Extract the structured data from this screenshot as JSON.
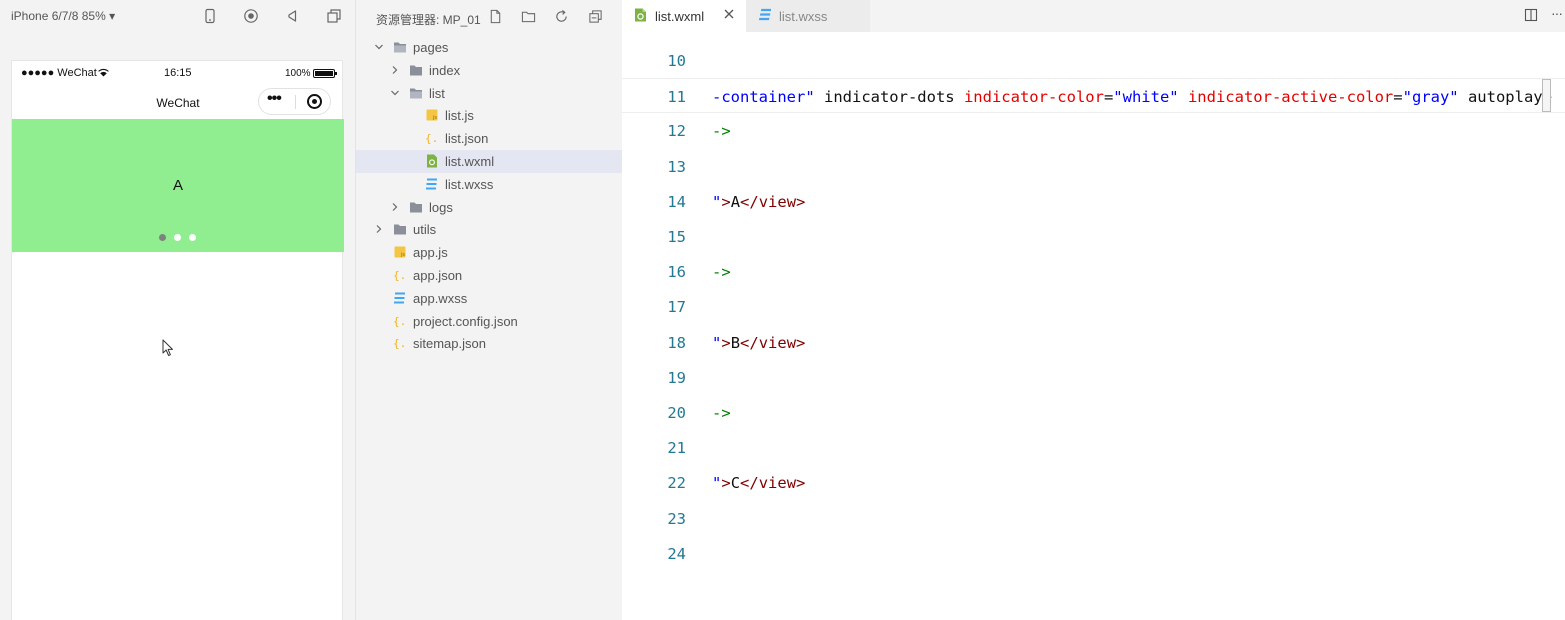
{
  "simulator": {
    "device": "iPhone 6/7/8 85% ▾",
    "status_bar": {
      "left": "●●●●● WeChat",
      "time": "16:15",
      "battery": "100%"
    },
    "nav": {
      "title": "WeChat",
      "capsule_dots": "•••"
    },
    "swiper": {
      "text": "A",
      "color": "#90ee90",
      "indicator_count": 3,
      "active_index": 0,
      "indicator_color": "white",
      "indicator_active_color": "gray"
    }
  },
  "explorer": {
    "title": "资源管理器: MP_01",
    "tree": [
      {
        "label": "pages",
        "type": "folder",
        "depth": 1,
        "expanded": true,
        "icon": "folder-open-icon"
      },
      {
        "label": "index",
        "type": "folder",
        "depth": 2,
        "expanded": false,
        "icon": "folder-icon"
      },
      {
        "label": "list",
        "type": "folder",
        "depth": 2,
        "expanded": true,
        "icon": "folder-open-icon"
      },
      {
        "label": "list.js",
        "type": "file",
        "depth": 3,
        "icon": "js-file-icon"
      },
      {
        "label": "list.json",
        "type": "file",
        "depth": 3,
        "icon": "json-file-icon"
      },
      {
        "label": "list.wxml",
        "type": "file",
        "depth": 3,
        "icon": "wxml-file-icon",
        "selected": true
      },
      {
        "label": "list.wxss",
        "type": "file",
        "depth": 3,
        "icon": "wxss-file-icon"
      },
      {
        "label": "logs",
        "type": "folder",
        "depth": 2,
        "expanded": false,
        "icon": "folder-icon"
      },
      {
        "label": "utils",
        "type": "folder",
        "depth": 1,
        "expanded": false,
        "icon": "folder-icon"
      },
      {
        "label": "app.js",
        "type": "file",
        "depth": 1,
        "icon": "js-file-icon"
      },
      {
        "label": "app.json",
        "type": "file",
        "depth": 1,
        "icon": "json-file-icon"
      },
      {
        "label": "app.wxss",
        "type": "file",
        "depth": 1,
        "icon": "wxss-file-icon"
      },
      {
        "label": "project.config.json",
        "type": "file",
        "depth": 1,
        "icon": "json-file-icon"
      },
      {
        "label": "sitemap.json",
        "type": "file",
        "depth": 1,
        "icon": "json-file-icon"
      }
    ]
  },
  "editor": {
    "tabs": [
      {
        "label": "list.wxml",
        "active": true
      },
      {
        "label": "list.wxss",
        "active": false
      }
    ],
    "lines": [
      {
        "num": "10",
        "tokens": []
      },
      {
        "num": "11",
        "current": true,
        "tokens": [
          {
            "t": "str",
            "v": "-container\""
          },
          {
            "t": "plain",
            "v": " indicator-dots "
          },
          {
            "t": "attr",
            "v": "indicator-color"
          },
          {
            "t": "plain",
            "v": "="
          },
          {
            "t": "str",
            "v": "\"white\""
          },
          {
            "t": "plain",
            "v": " "
          },
          {
            "t": "attr",
            "v": "indicator-active-color"
          },
          {
            "t": "plain",
            "v": "="
          },
          {
            "t": "str",
            "v": "\"gray\""
          },
          {
            "t": "plain",
            "v": " autoplay"
          },
          {
            "t": "tag",
            "v": ">"
          }
        ]
      },
      {
        "num": "12",
        "tokens": [
          {
            "t": "cmt",
            "v": "->"
          }
        ]
      },
      {
        "num": "13",
        "tokens": []
      },
      {
        "num": "14",
        "tokens": [
          {
            "t": "str",
            "v": "\""
          },
          {
            "t": "tag",
            "v": ">"
          },
          {
            "t": "plain",
            "v": "A"
          },
          {
            "t": "tag",
            "v": "</view>"
          }
        ]
      },
      {
        "num": "15",
        "tokens": []
      },
      {
        "num": "16",
        "tokens": [
          {
            "t": "cmt",
            "v": "->"
          }
        ]
      },
      {
        "num": "17",
        "tokens": []
      },
      {
        "num": "18",
        "tokens": [
          {
            "t": "str",
            "v": "\""
          },
          {
            "t": "tag",
            "v": ">"
          },
          {
            "t": "plain",
            "v": "B"
          },
          {
            "t": "tag",
            "v": "</view>"
          }
        ]
      },
      {
        "num": "19",
        "tokens": []
      },
      {
        "num": "20",
        "tokens": [
          {
            "t": "cmt",
            "v": "->"
          }
        ]
      },
      {
        "num": "21",
        "tokens": []
      },
      {
        "num": "22",
        "tokens": [
          {
            "t": "str",
            "v": "\""
          },
          {
            "t": "tag",
            "v": ">"
          },
          {
            "t": "plain",
            "v": "C"
          },
          {
            "t": "tag",
            "v": "</view>"
          }
        ]
      },
      {
        "num": "23",
        "tokens": []
      },
      {
        "num": "24",
        "tokens": []
      }
    ]
  },
  "colors": {
    "swiper_bg": "#90ee90",
    "attr": "#e50000",
    "string": "#0000ff",
    "tag": "#800000",
    "comment": "#008000",
    "line_number": "#237893",
    "selection": "#e4e6f1"
  }
}
